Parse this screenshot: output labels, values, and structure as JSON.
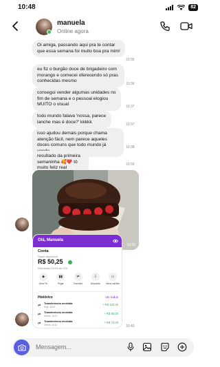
{
  "status_bar": {
    "time": "10:48",
    "battery": "82"
  },
  "header": {
    "name": "manuela",
    "status": "Online agora"
  },
  "messages": [
    {
      "text": "Oi amiga, passando aqui pra te contar que essa semana foi muito boa pra mim!",
      "time": "10:35"
    },
    {
      "text": "eu fiz o burgão doce de brigadeiro com morango e comecei oferecendo só pras conhecidas mesmo",
      "time": "10:36"
    },
    {
      "text": "consegui vender algumas unidades no fim de semana e o pessoal elogiou MUITO o visual",
      "time": "10:37"
    },
    {
      "text": "todo mundo falava 'nossa, parece lanche mas é doce?' kkkkk",
      "time": "10:37"
    },
    {
      "text": "isso ajudou demais porque chama atenção fácil, nem parece aqueles doces comuns que todo mundo já vende",
      "time": "10:38"
    },
    {
      "text": "resultado da primeira semaninha 🥰❤️ tô muito feliz real",
      "time": "10:39"
    }
  ],
  "photo_time": "10:39",
  "card_time": "10:40",
  "bank_card": {
    "greeting": "Olá, Manuela",
    "account_label": "Conta",
    "balance_label": "Saldo disponível",
    "balance": "R$ 50,25",
    "yield_text": "Rendendo 110% do CDI",
    "actions": [
      {
        "label": "Área Pix",
        "icon": "◆"
      },
      {
        "label": "Pagar",
        "icon": "▮▮"
      },
      {
        "label": "Transferir",
        "icon": "⇄"
      },
      {
        "label": "Depositar",
        "icon": "⇩"
      },
      {
        "label": "Meus cartões",
        "icon": "▭"
      }
    ],
    "history_title": "Histórico",
    "see_all": "Ver todos",
    "transactions": [
      {
        "title": "Transferência recebida",
        "date": "Hoje, 18:47",
        "amount": "+ R$ 120,00"
      },
      {
        "title": "Transferência recebida",
        "date": "Ontem, 15:07",
        "amount": "+ R$ 85,00"
      },
      {
        "title": "Transferência recebida",
        "date": "Ontem, 14:10",
        "amount": "+ R$ 75,00"
      }
    ]
  },
  "input": {
    "placeholder": "Mensagem..."
  },
  "colors": {
    "brand_purple": "#7b2fd3",
    "camera_button": "#5a5fe0",
    "positive_green": "#32b35a"
  }
}
